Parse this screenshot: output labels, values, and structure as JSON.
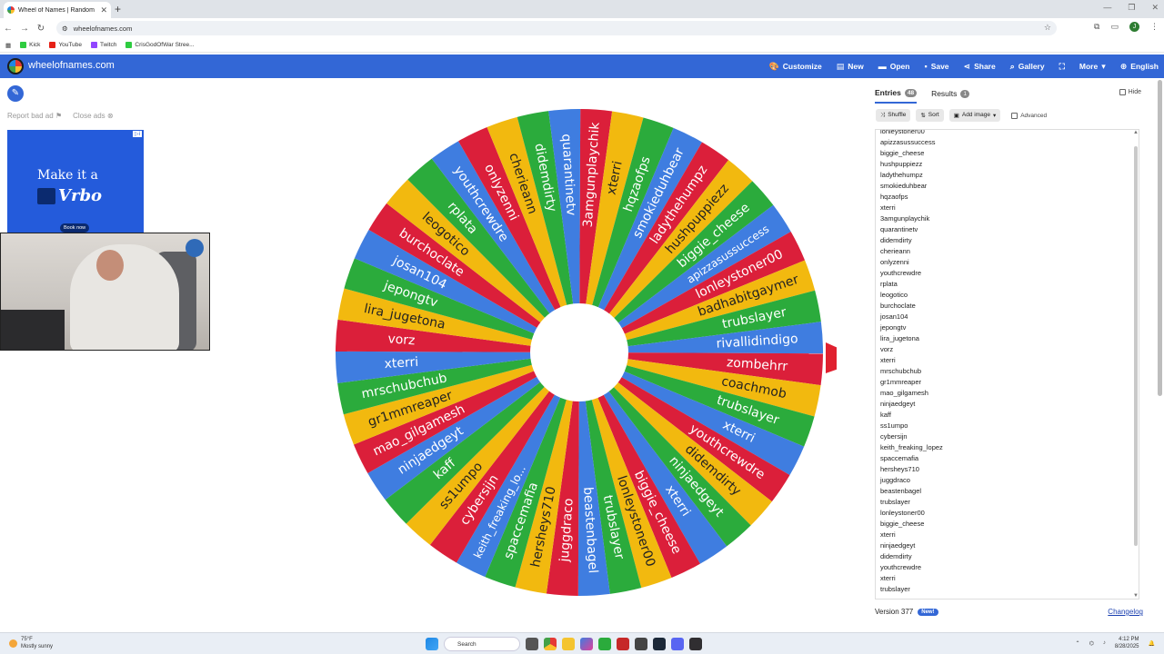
{
  "browser": {
    "tab_title": "Wheel of Names | Random nam",
    "url": "wheelofnames.com",
    "bookmarks": [
      {
        "label": "Kick",
        "color": "#2ecc40"
      },
      {
        "label": "YouTube",
        "color": "#e62117"
      },
      {
        "label": "Twitch",
        "color": "#9146ff"
      },
      {
        "label": "CrisGodOfWar Stree...",
        "color": "#2ecc40"
      }
    ]
  },
  "app": {
    "brand": "wheelofnames.com",
    "accent": "#3367d6",
    "menu": [
      {
        "label": "Customize",
        "icon": "palette-icon"
      },
      {
        "label": "New",
        "icon": "document-icon"
      },
      {
        "label": "Open",
        "icon": "folder-icon"
      },
      {
        "label": "Save",
        "icon": "floppy-icon"
      },
      {
        "label": "Share",
        "icon": "share-icon"
      },
      {
        "label": "Gallery",
        "icon": "search-icon"
      },
      {
        "label": "",
        "icon": "fullscreen-icon"
      },
      {
        "label": "More",
        "icon": "chevron-down-icon"
      },
      {
        "label": "English",
        "icon": "globe-icon"
      }
    ]
  },
  "left": {
    "report_ad": "Report bad ad",
    "close_ads": "Close ads",
    "ad_line1": "Make it a",
    "ad_line2": "Vrbo",
    "ad_button": "Book now"
  },
  "wheel": {
    "colors": [
      "#db1f3a",
      "#f2b90f",
      "#2bab3c",
      "#3f7de0"
    ],
    "pointer_color": "#e0202f",
    "slices": [
      "3amgunplaychik",
      "xterri",
      "hqzaofps",
      "smokieduhbear",
      "ladythehumpz",
      "hushpuppiezz",
      "biggie_cheese",
      "apizzasussuccess",
      "lonleystoner00",
      "badhabitgaymer",
      "trubslayer",
      "rivallidindigo",
      "zombehrr",
      "coachmob",
      "trubslayer",
      "xterri",
      "youthcrewdre",
      "didemdirty",
      "ninjaedgeyt",
      "xterri",
      "biggie_cheese",
      "lonleystoner00",
      "trubslayer",
      "beastenbagel",
      "juggdraco",
      "hersheys710",
      "spaccemafia",
      "keith_freaking_lo...",
      "cybersijn",
      "ss1umpo",
      "kaff",
      "ninjaedgeyt",
      "mao_gilgamesh",
      "gr1mmreaper",
      "mrschubchub",
      "xterri",
      "vorz",
      "lira_jugetona",
      "jepongtv",
      "josan104",
      "burchoclate",
      "leogotico",
      "rplata",
      "youthcrewdre",
      "onlyzenni",
      "cherieann",
      "didemdirty",
      "quarantinetv"
    ]
  },
  "panel": {
    "tab_entries": "Entries",
    "entries_count": "48",
    "tab_results": "Results",
    "results_count": "1",
    "hide_label": "Hide",
    "shuffle": "Shuffle",
    "sort": "Sort",
    "add_image": "Add image",
    "advanced": "Advanced",
    "entries": [
      "lonleystoner00",
      "apizzasussuccess",
      "biggie_cheese",
      "hushpuppiezz",
      "ladythehumpz",
      "smokieduhbear",
      "hqzaofps",
      "xterri",
      "3amgunplaychik",
      "quarantinetv",
      "didemdirty",
      "cherieann",
      "onlyzenni",
      "youthcrewdre",
      "rplata",
      "leogotico",
      "burchoclate",
      "josan104",
      "jepongtv",
      "lira_jugetona",
      "vorz",
      "xterri",
      "mrschubchub",
      "gr1mmreaper",
      "mao_gilgamesh",
      "ninjaedgeyt",
      "kaff",
      "ss1umpo",
      "cybersijn",
      "keith_freaking_lopez",
      "spaccemafia",
      "hersheys710",
      "juggdraco",
      "beastenbagel",
      "trubslayer",
      "lonleystoner00",
      "biggie_cheese",
      "xterri",
      "ninjaedgeyt",
      "didemdirty",
      "youthcrewdre",
      "xterri",
      "trubslayer"
    ],
    "version": "Version 377",
    "new_badge": "New!",
    "changelog": "Changelog"
  },
  "taskbar": {
    "temp": "75°F",
    "weather": "Mostly sunny",
    "search": "Search",
    "time": "4:12 PM",
    "date": "8/28/2025"
  }
}
